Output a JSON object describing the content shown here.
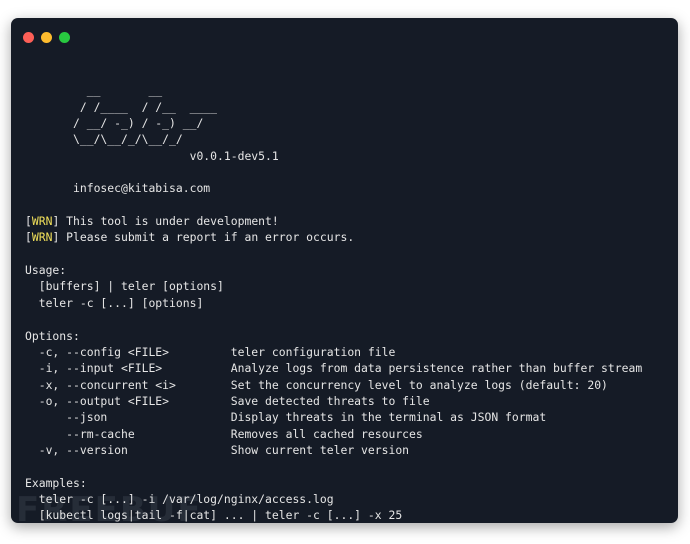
{
  "window": {
    "colors": {
      "background": "#151b26",
      "close": "#fd5f57",
      "minimize": "#febc2e",
      "maximize": "#28c840",
      "warn": "#f1e05a",
      "text": "#e6e6e6"
    }
  },
  "banner": {
    "ascii": [
      "                                  ",
      "         __       __              ",
      "        / /____  / /__  ____      ",
      "       / __/ -_) / -_) __/        ",
      "       \\__/\\__/_/\\__/_/           ",
      "                        v0.0.1-dev5.1"
    ],
    "blank": "",
    "contact": "       infosec@kitabisa.com"
  },
  "warnings": [
    {
      "tag": "WRN",
      "text": " This tool is under development!"
    },
    {
      "tag": "WRN",
      "text": " Please submit a report if an error occurs."
    }
  ],
  "usage": {
    "header": "Usage:",
    "lines": [
      "  [buffers] | teler [options]",
      "  teler -c [...] [options]"
    ]
  },
  "options": {
    "header": "Options:",
    "lines": [
      "  -c, --config <FILE>         teler configuration file",
      "  -i, --input <FILE>          Analyze logs from data persistence rather than buffer stream",
      "  -x, --concurrent <i>        Set the concurrency level to analyze logs (default: 20)",
      "  -o, --output <FILE>         Save detected threats to file",
      "      --json                  Display threats in the terminal as JSON format",
      "      --rm-cache              Removes all cached resources",
      "  -v, --version               Show current teler version"
    ]
  },
  "examples": {
    "header": "Examples:",
    "lines": [
      "  teler -c [...] -i /var/log/nginx/access.log",
      "  [kubectl logs|tail -f|cat] ... | teler -c [...] -x 25"
    ]
  },
  "watermark": "FREEBUF"
}
